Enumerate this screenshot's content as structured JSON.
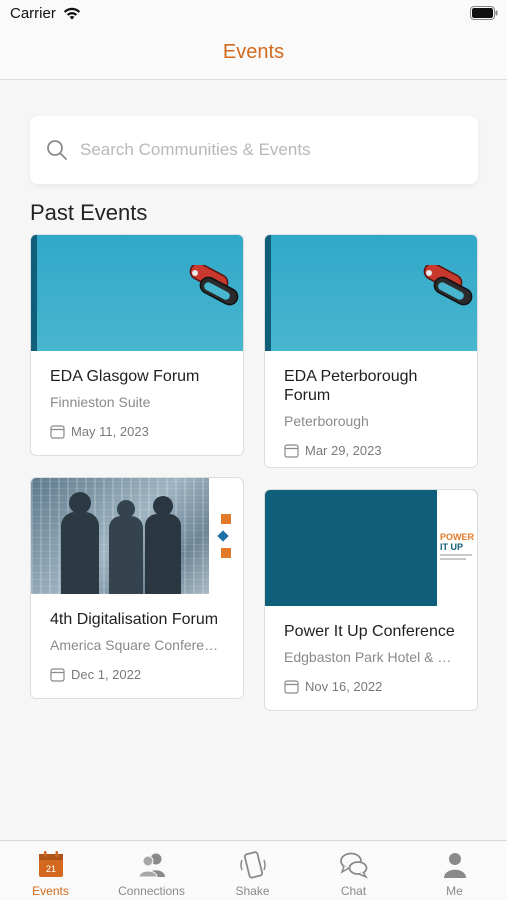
{
  "status_bar": {
    "carrier": "Carrier"
  },
  "header": {
    "title": "Events"
  },
  "search": {
    "placeholder": "Search Communities & Events",
    "value": ""
  },
  "section": {
    "title": "Past Events"
  },
  "events": [
    {
      "title": "EDA Glasgow  Forum",
      "location": "Finnieston Suite",
      "date": "May 11, 2023",
      "image": "teal-carabiner-banner"
    },
    {
      "title": "EDA Peterborough Forum",
      "location": "Peterborough",
      "date": "Mar 29, 2023",
      "image": "teal-carabiner-banner"
    },
    {
      "title": "4th Digitalisation Forum",
      "location": "America Square Conference...",
      "date": "Dec  1, 2022",
      "image": "digital-people-photo"
    },
    {
      "title": "Power It Up Conference",
      "location": "Edgbaston Park Hotel & Con...",
      "date": "Nov 16, 2022",
      "image": "power-it-up-banner"
    }
  ],
  "power_logo": {
    "line1": "POWER",
    "line2": "IT UP"
  },
  "tabs": [
    {
      "label": "Events",
      "icon": "calendar-icon",
      "badge": "21",
      "active": true
    },
    {
      "label": "Connections",
      "icon": "people-icon",
      "active": false
    },
    {
      "label": "Shake",
      "icon": "phone-shake-icon",
      "active": false
    },
    {
      "label": "Chat",
      "icon": "chat-bubbles-icon",
      "active": false
    },
    {
      "label": "Me",
      "icon": "person-icon",
      "active": false
    }
  ],
  "colors": {
    "accent": "#d2691e",
    "teal": "#3aafcc",
    "dark_teal": "#0f5f7a"
  }
}
